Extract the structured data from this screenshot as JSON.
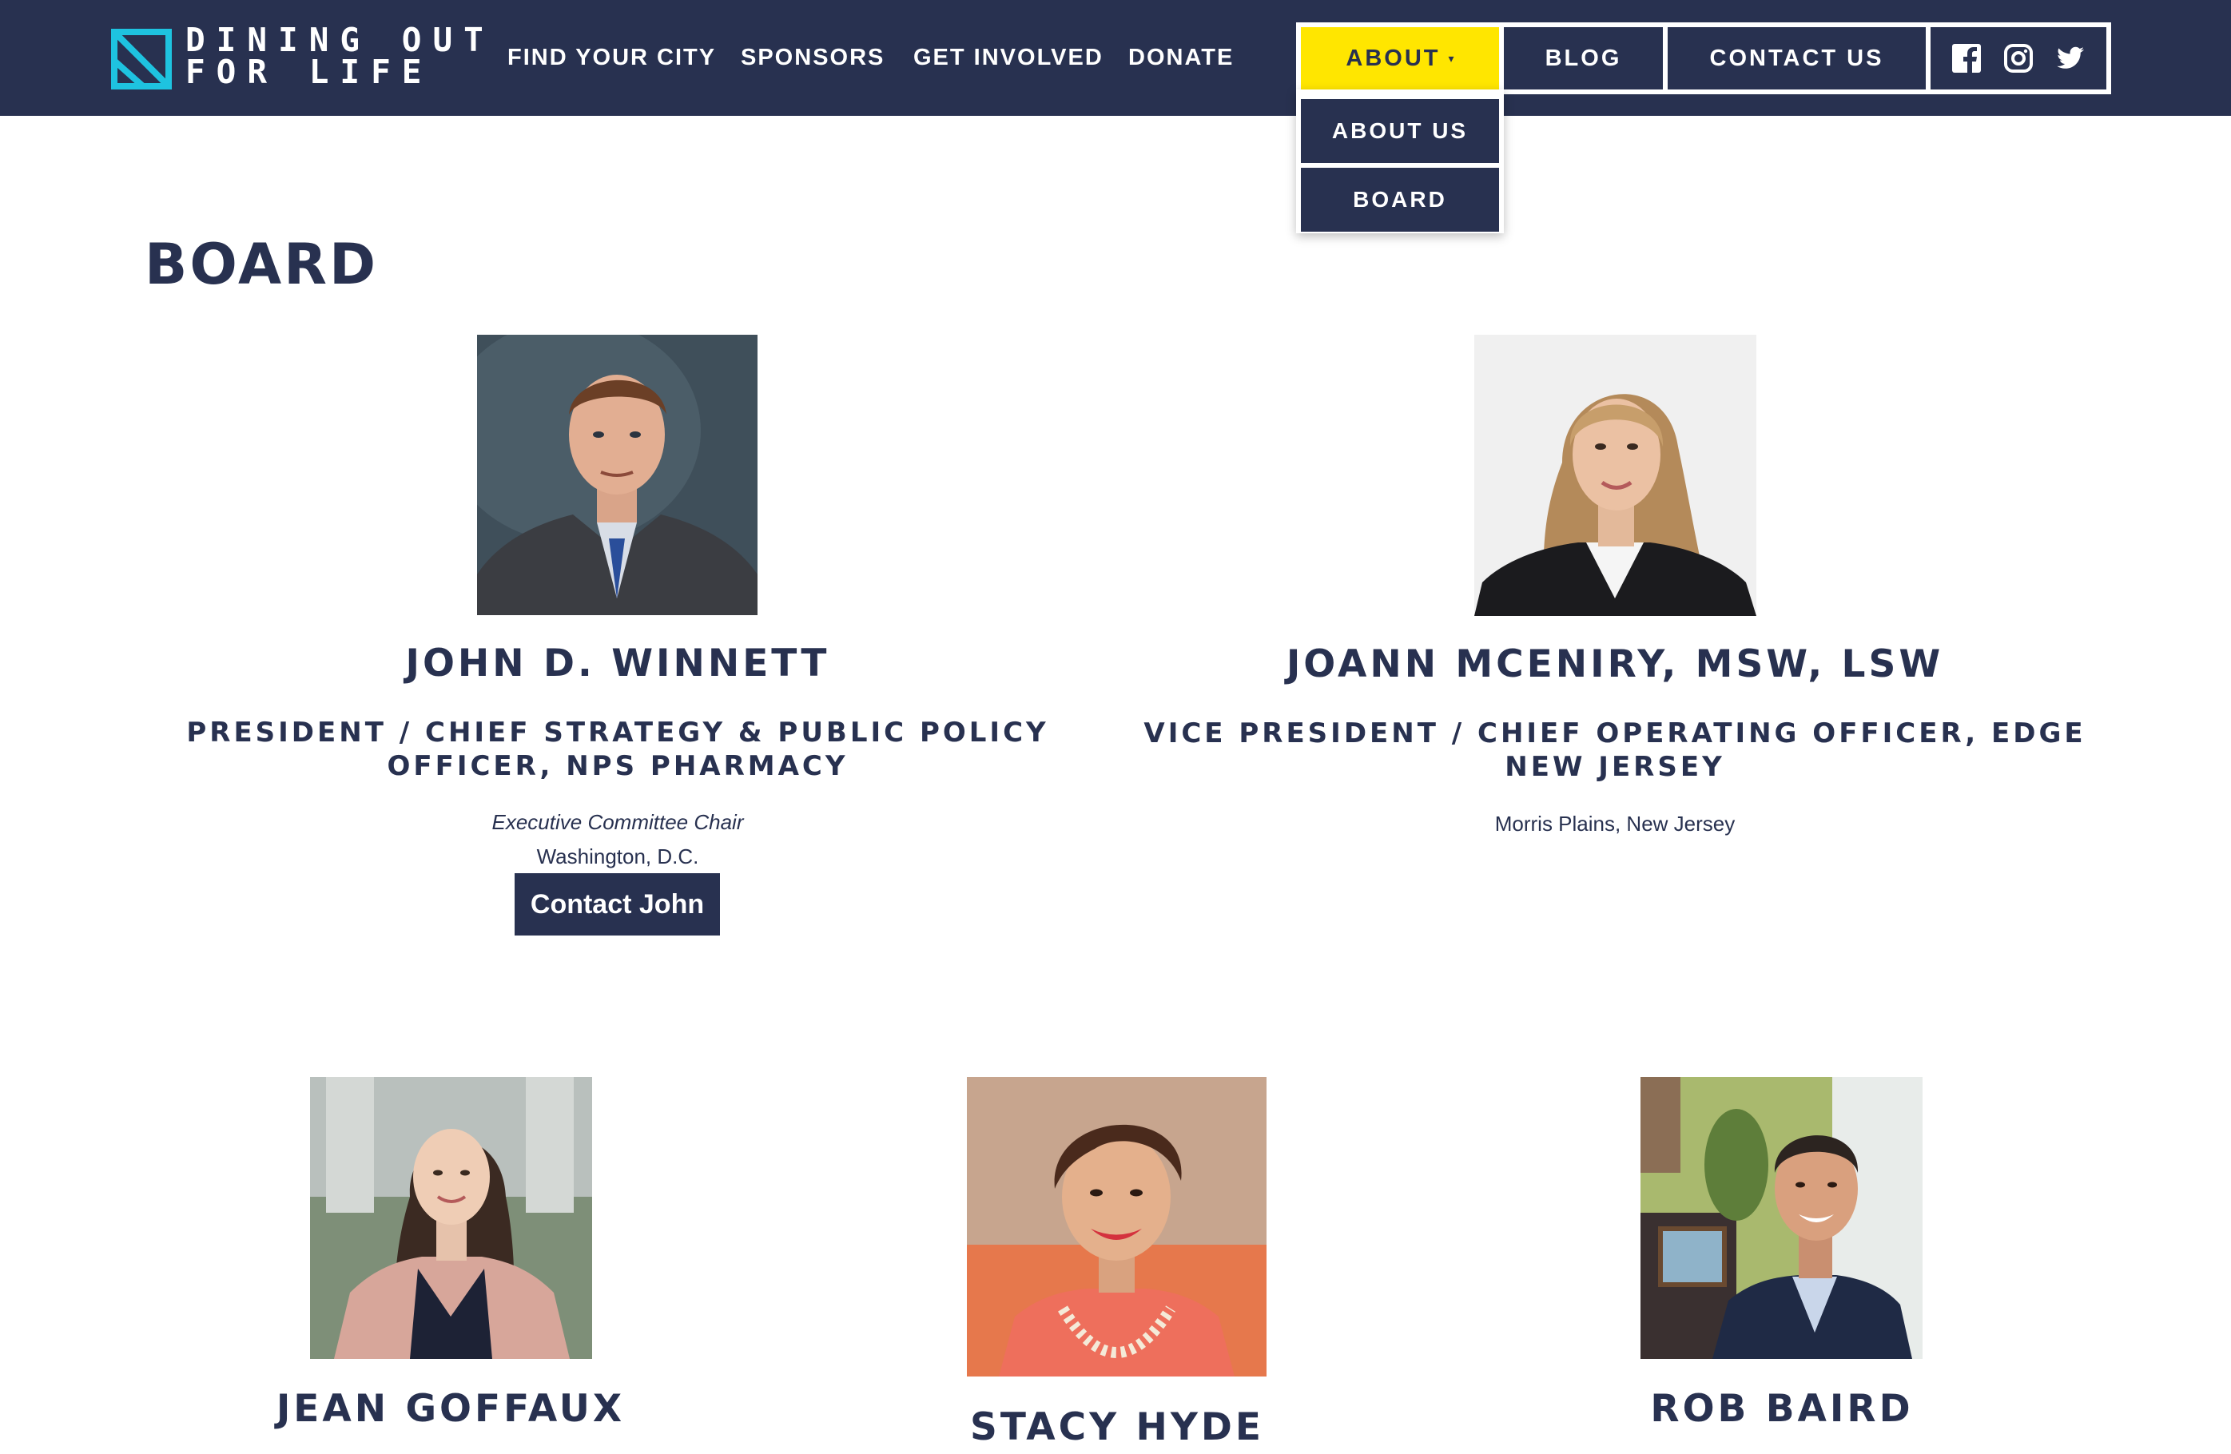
{
  "header": {
    "logo": {
      "line1": "DINING OUT",
      "line2": "FOR LIFE",
      "mark_color": "#1ec3e0"
    },
    "nav": [
      "FIND YOUR CITY",
      "SPONSORS",
      "GET INVOLVED",
      "DONATE"
    ],
    "about_label": "ABOUT",
    "about_caret": "▾",
    "blog_label": "BLOG",
    "contact_label": "CONTACT US",
    "social_icons": [
      "facebook-icon",
      "instagram-icon",
      "twitter-icon"
    ],
    "dropdown": [
      "ABOUT US",
      "BOARD"
    ]
  },
  "colors": {
    "navy": "#283150",
    "accent_yellow": "#ffe600",
    "logo_cyan": "#1ec3e0",
    "white": "#ffffff"
  },
  "page": {
    "title": "BOARD"
  },
  "board": [
    {
      "name": "JOHN D. WINNETT",
      "role": "PRESIDENT / CHIEF STRATEGY & PUBLIC POLICY OFFICER, NPS PHARMACY",
      "note": "Executive Committee Chair",
      "location": "Washington, D.C.",
      "button": "Contact John"
    },
    {
      "name": "JOANN MCENIRY, MSW, LSW",
      "role": "VICE PRESIDENT / CHIEF OPERATING OFFICER, EDGE NEW JERSEY",
      "location": "Morris Plains, New Jersey"
    },
    {
      "name": "JEAN GOFFAUX"
    },
    {
      "name": "STACY HYDE"
    },
    {
      "name": "ROB BAIRD"
    }
  ]
}
